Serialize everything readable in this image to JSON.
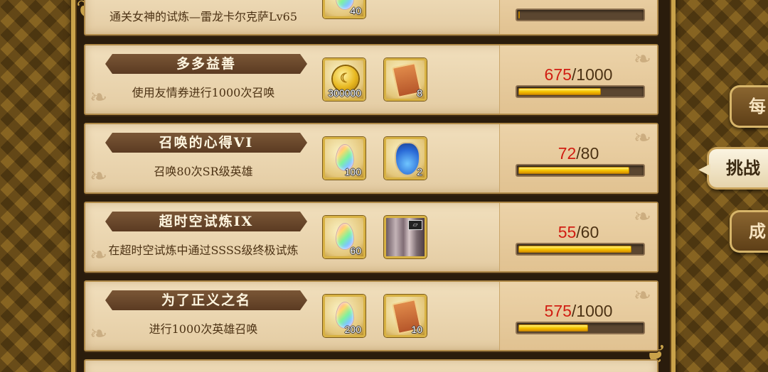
{
  "missions": [
    {
      "title": "",
      "description": "通关女神的试炼—雷龙卡尔克萨Lv65",
      "rewards": [
        {
          "icon": "gem-icon",
          "qty": "40"
        }
      ],
      "current": "",
      "total": "",
      "fraction": 0
    },
    {
      "title": "多多益善",
      "description": "使用友情券进行1000次召唤",
      "rewards": [
        {
          "icon": "gold-coin-icon",
          "qty": "300000"
        },
        {
          "icon": "summon-ticket-icon",
          "qty": "8"
        }
      ],
      "current": "675",
      "total": "/1000",
      "fraction": 0.675
    },
    {
      "title": "召唤的心得VI",
      "description": "召唤80次SR级英雄",
      "rewards": [
        {
          "icon": "gem-icon",
          "qty": "100"
        },
        {
          "icon": "potion-icon",
          "qty": "2"
        }
      ],
      "current": "72",
      "total": "/80",
      "fraction": 0.9
    },
    {
      "title": "超时空试炼IX",
      "description": "在超时空试炼中通过SSSS级终极试炼",
      "rewards": [
        {
          "icon": "gem-icon",
          "qty": "60"
        },
        {
          "icon": "pillar-background-icon",
          "qty": ""
        }
      ],
      "current": "55",
      "total": "/60",
      "fraction": 0.917
    },
    {
      "title": "为了正义之名",
      "description": "进行1000次英雄召唤",
      "rewards": [
        {
          "icon": "gem-icon",
          "qty": "200"
        },
        {
          "icon": "summon-ticket-icon",
          "qty": "10"
        }
      ],
      "current": "575",
      "total": "/1000",
      "fraction": 0.575
    }
  ],
  "tabs": {
    "daily": "每",
    "challenge": "挑战",
    "achievement": "成"
  }
}
